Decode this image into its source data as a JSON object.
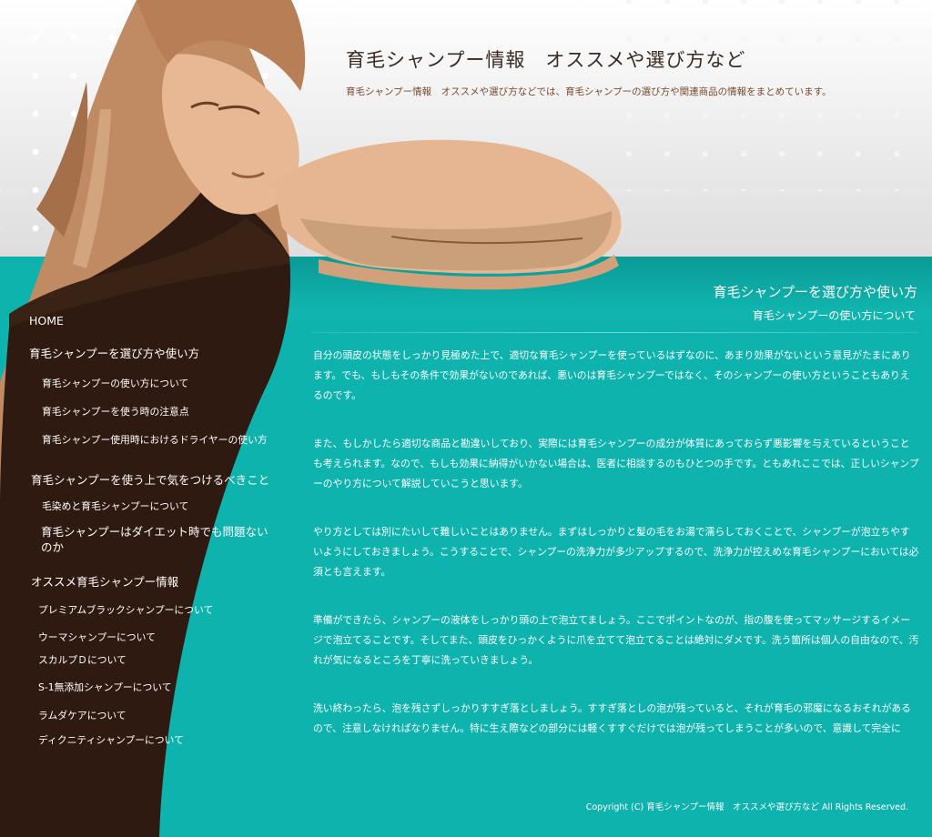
{
  "header": {
    "site_title": "育毛シャンプー情報　オススメや選び方など",
    "site_description": "育毛シャンプー情報　オススメや選び方などでは、育毛シャンプーの選び方や関連商品の情報をまとめています。"
  },
  "sidebar": {
    "home": "HOME",
    "section1": {
      "title": "育毛シャンプーを選び方や使い方",
      "items": [
        "育毛シャンプーの使い方について",
        "育毛シャンプーを使う時の注意点",
        "育毛シャンプー使用時におけるドライヤーの使い方"
      ]
    },
    "section2": {
      "title": "育毛シャンプーを使う上で気をつけるべきこと",
      "items": [
        "毛染めと育毛シャンプーについて",
        "育毛シャンプーはダイエット時でも問題ないのか"
      ]
    },
    "section3": {
      "title": "オススメ育毛シャンプー情報",
      "items": [
        "プレミアムブラックシャンプーについて",
        "ウーマシャンプーについて",
        "スカルプＤについて",
        "S-1無添加シャンプーについて",
        "ラムダケアについて",
        "ディクニティシャンプーについて"
      ]
    }
  },
  "main": {
    "section_title": "育毛シャンプーを選び方や使い方",
    "page_title": "育毛シャンプーの使い方について",
    "paragraphs": [
      "自分の頭皮の状態をしっかり見極めた上で、適切な育毛シャンプーを使っているはずなのに、あまり効果がないという意見がたまにあります。でも、もしもその条件で効果がないのであれば、悪いのは育毛シャンプーではなく、そのシャンプーの使い方ということもありえるのです。",
      "また、もしかしたら適切な商品と勘違いしており、実際には育毛シャンプーの成分が体質にあっておらず悪影響を与えているということも考えられます。なので、もしも効果に納得がいかない場合は、医者に相談するのもひとつの手です。ともあれここでは、正しいシャンプーのやり方について解説していこうと思います。",
      "やり方としては別にたいして難しいことはありません。まずはしっかりと髪の毛をお湯で濡らしておくことで、シャンプーが泡立ちやすいようにしておきましょう。こうすることで、シャンプーの洗浄力が多少アップするので、洗浄力が控えめな育毛シャンプーにおいては必須とも言えます。",
      "準備ができたら、シャンプーの液体をしっかり頭の上で泡立てましょう。ここでポイントなのが、指の腹を使ってマッサージするイメージで泡立てることです。そしてまた、頭皮をひっかくように爪を立てて泡立てることは絶対にダメです。洗う箇所は個人の自由なので、汚れが気になるところを丁寧に洗っていきましょう。",
      "洗い終わったら、泡を残さずしっかりすすぎ落としましょう。すすぎ落としの泡が残っていると、それが育毛の邪魔になるおそれがあるので、注意しなければなりません。特に生え際などの部分には軽くすすぐだけでは泡が残ってしまうことが多いので、意識して完全に"
    ]
  },
  "footer": {
    "copyright": "Copyright (C)  育毛シャンプー情報　オススメや選び方など  All Rights Reserved."
  },
  "colors": {
    "teal": "#0fb3ad",
    "brown_dark": "#2e1a10",
    "skin": "#e8b894"
  }
}
